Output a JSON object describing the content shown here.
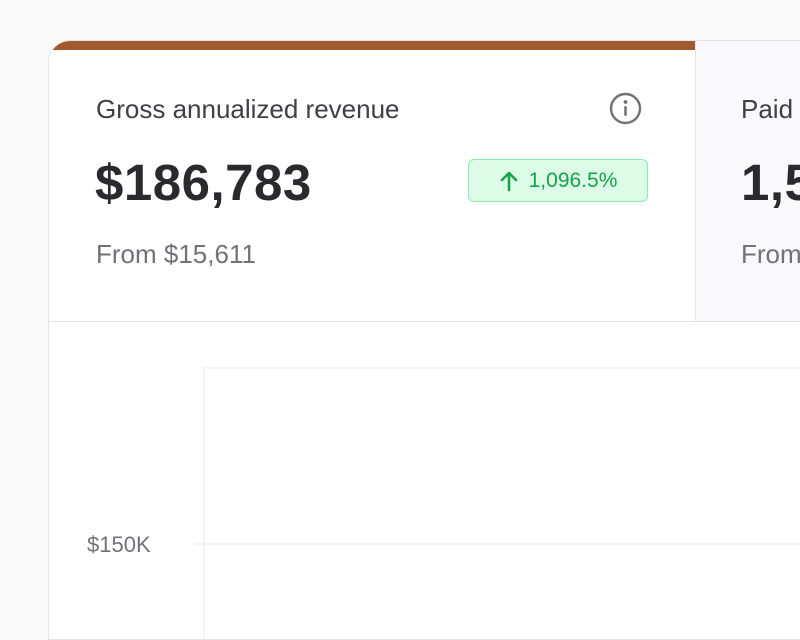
{
  "metrics": [
    {
      "title": "Gross annualized revenue",
      "value": "$186,783",
      "change": "1,096.5%",
      "from": "From $15,611"
    },
    {
      "title": "Paid",
      "value": "1,5",
      "from": "From"
    }
  ],
  "colors": {
    "accent": "#a05a2c",
    "positive": "#16a34a",
    "positive_bg": "#dcfce7"
  },
  "chart_data": {
    "type": "line",
    "y_ticks": [
      "$150K"
    ],
    "series": []
  }
}
